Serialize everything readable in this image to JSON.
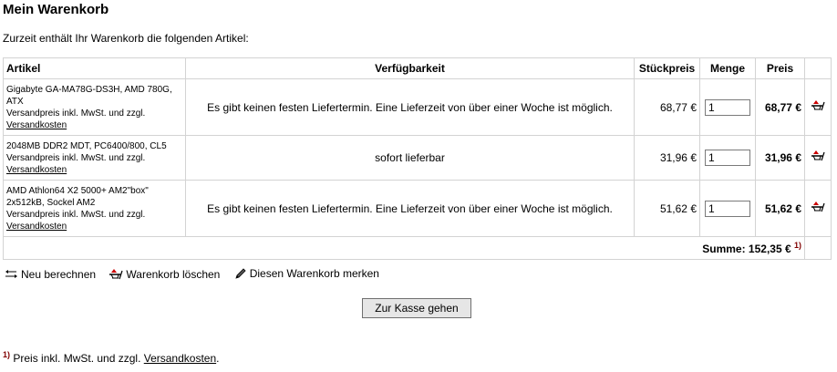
{
  "page": {
    "title": "Mein Warenkorb",
    "intro": "Zurzeit enthält Ihr Warenkorb die folgenden Artikel:"
  },
  "table": {
    "headers": {
      "article": "Artikel",
      "availability": "Verfügbarkeit",
      "unit_price": "Stückpreis",
      "quantity": "Menge",
      "price": "Preis"
    },
    "rows": [
      {
        "name": "Gigabyte GA-MA78G-DS3H, AMD 780G, ATX",
        "shipping_note": "Versandpreis inkl. MwSt. und zzgl.",
        "shipping_link": "Versandkosten",
        "availability": "Es gibt keinen festen Liefertermin. Eine Lieferzeit von über einer Woche ist möglich.",
        "unit_price": "68,77 €",
        "quantity": "1",
        "price": "68,77 €"
      },
      {
        "name": "2048MB DDR2 MDT, PC6400/800, CL5",
        "shipping_note": "Versandpreis inkl. MwSt. und zzgl.",
        "shipping_link": "Versandkosten",
        "availability": "sofort lieferbar",
        "unit_price": "31,96 €",
        "quantity": "1",
        "price": "31,96 €"
      },
      {
        "name": "AMD Athlon64 X2 5000+ AM2\"box\" 2x512kB, Sockel AM2",
        "shipping_note": "Versandpreis inkl. MwSt. und zzgl.",
        "shipping_link": "Versandkosten",
        "availability": "Es gibt keinen festen Liefertermin. Eine Lieferzeit von über einer Woche ist möglich.",
        "unit_price": "51,62 €",
        "quantity": "1",
        "price": "51,62 €"
      }
    ],
    "sum_text": "Summe: 152,35 €",
    "sum_footnote": "1)"
  },
  "actions": {
    "recalculate": "Neu berechnen",
    "clear_cart": "Warenkorb löschen",
    "remember_cart": "Diesen Warenkorb merken",
    "recalculate_icon": "swap-arrows-icon",
    "clear_icon": "cart-delete-icon",
    "remember_icon": "pencil-icon"
  },
  "checkout": {
    "label": "Zur Kasse gehen"
  },
  "footnote": {
    "marker": "1)",
    "text": "Preis inkl. MwSt. und zzgl.",
    "link": "Versandkosten",
    "period": "."
  },
  "colors": {
    "footnote_marker": "#800000",
    "icon_red": "#cc0000",
    "border": "#d3d3d3"
  }
}
